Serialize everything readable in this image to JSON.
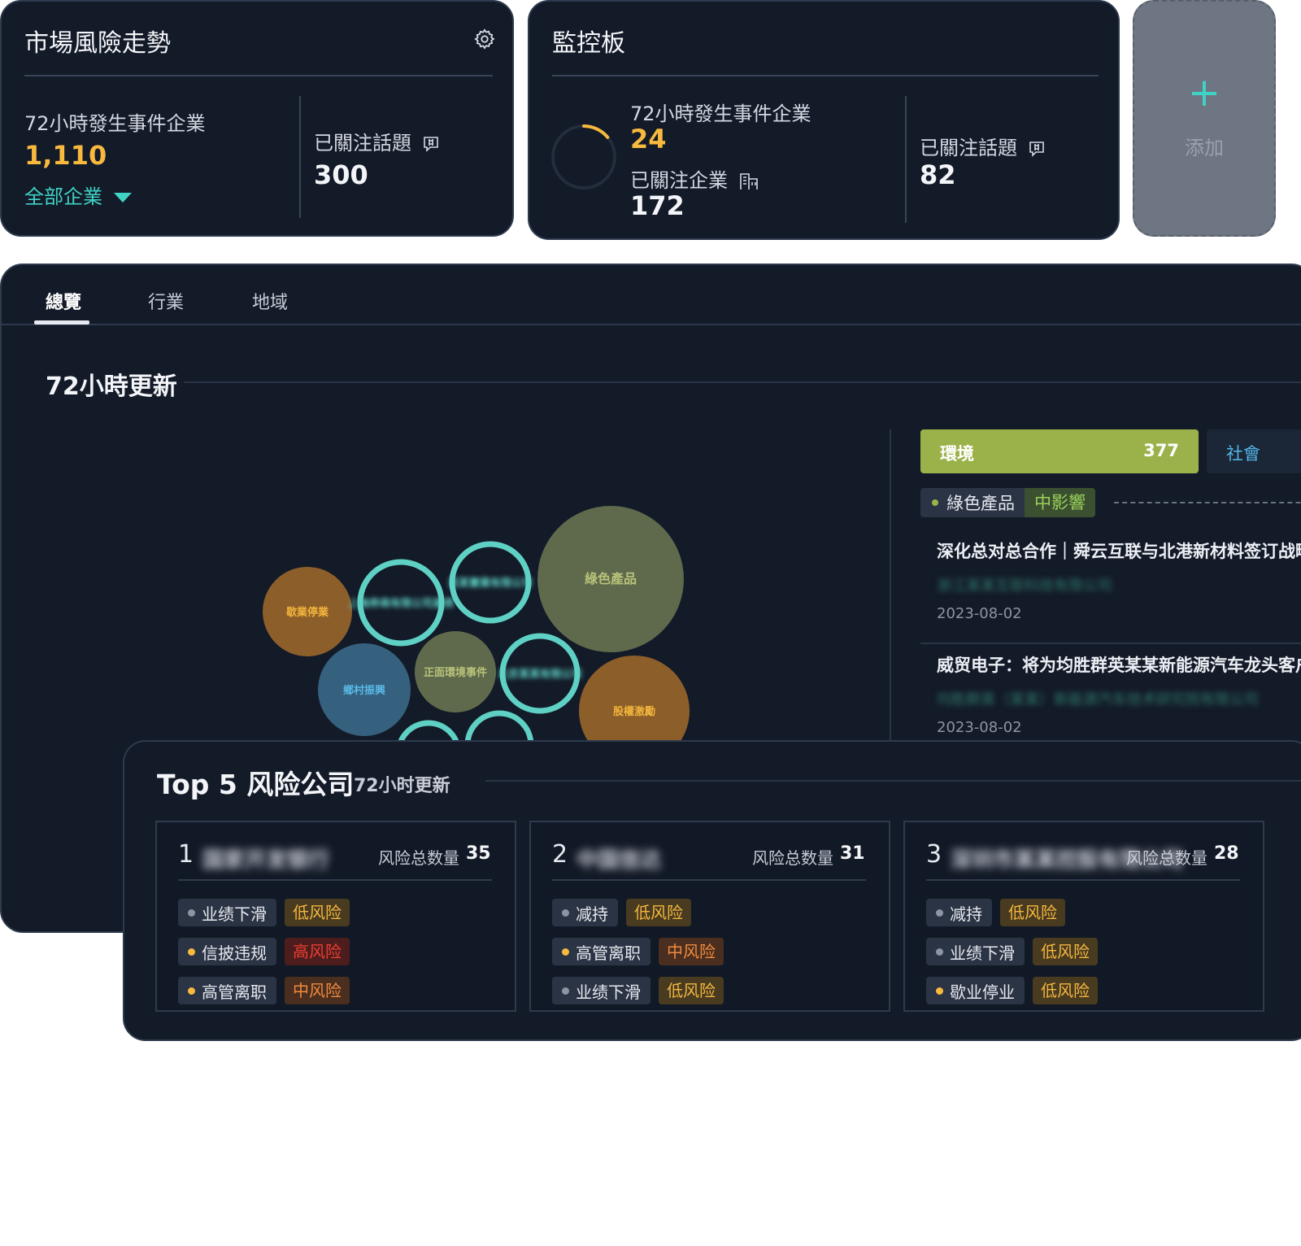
{
  "market_risk_card": {
    "title": "市場風險走勢",
    "events_label": "72小時發生事件企業",
    "events_value": "1,110",
    "filter_label": "全部企業",
    "topics_label": "已關注話題",
    "topics_value": "300"
  },
  "monitor_card": {
    "title": "監控板",
    "events_label": "72小時發生事件企業",
    "events_value": "24",
    "followed_label": "已關注企業",
    "followed_value": "172",
    "topics_label": "已關注話題",
    "topics_value": "82",
    "ring_progress": 0.14
  },
  "add_card": {
    "label": "添加"
  },
  "tabs": [
    "總覽",
    "行業",
    "地域"
  ],
  "update_section": {
    "title": "72小時更新",
    "bubbles": [
      {
        "label": "歇業停業",
        "color": "#8c5e2a",
        "text_color": "#f2b53c",
        "style": "fill"
      },
      {
        "label": "上海券商有限公司違規",
        "color": "#131a28",
        "ring": "#5fd0c4",
        "text_color": "#5fd0c4",
        "style": "ring",
        "blurred": true
      },
      {
        "label": "某某實業有限公司",
        "color": "#131a28",
        "ring": "#5fd0c4",
        "text_color": "#5fd0c4",
        "style": "ring",
        "blurred": true
      },
      {
        "label": "綠色產品",
        "color": "#5f6a4c",
        "text_color": "#b8c27a",
        "style": "fill"
      },
      {
        "label": "鄉村振興",
        "color": "#35607e",
        "text_color": "#59b8e6",
        "style": "fill"
      },
      {
        "label": "正面環境事件",
        "color": "#5f6a4c",
        "text_color": "#b8c27a",
        "style": "fill"
      },
      {
        "label": "北京某某有限公司",
        "color": "#131a28",
        "ring": "#5fd0c4",
        "text_color": "#5fd0c4",
        "style": "ring",
        "blurred": true
      },
      {
        "label": "股權激勵",
        "color": "#8c5e2a",
        "text_color": "#f2b53c",
        "style": "fill"
      },
      {
        "label": "",
        "color": "#131a28",
        "ring": "#5fd0c4",
        "text_color": "#5fd0c4",
        "style": "ring"
      },
      {
        "label": "",
        "color": "#131a28",
        "ring": "#5fd0c4",
        "text_color": "#5fd0c4",
        "style": "ring"
      }
    ],
    "category_env": {
      "name": "環境",
      "count": "377"
    },
    "category_social": {
      "name": "社會"
    },
    "topic": {
      "name": "綠色產品",
      "impact": "中影響"
    },
    "news": [
      {
        "headline": "深化总对总合作｜舜云互联与北港新材料签订战略",
        "company": "浙江某某互联科技有限公司",
        "date": "2023-08-02"
      },
      {
        "headline": "威贸电子：将为均胜群英某某新能源汽车龙头客户项",
        "company": "均胜群英（某某）新能源汽车技术研究院有限公司",
        "date": "2023-08-02"
      }
    ]
  },
  "top5": {
    "title": "Top 5 风险公司",
    "subtitle": "72小时更新",
    "total_label": "风险总数量",
    "companies": [
      {
        "rank": "1",
        "name": "国家开发银行",
        "total": "35",
        "risks": [
          {
            "name": "业绩下滑",
            "dot": "#8d95a3",
            "level": "低风险",
            "level_class": "low"
          },
          {
            "name": "信披违规",
            "dot": "#f7b93e",
            "level": "高风险",
            "level_class": "high"
          },
          {
            "name": "高管离职",
            "dot": "#f7b93e",
            "level": "中风险",
            "level_class": "mid"
          }
        ]
      },
      {
        "rank": "2",
        "name": "中国信达",
        "total": "31",
        "risks": [
          {
            "name": "减持",
            "dot": "#8d95a3",
            "level": "低风险",
            "level_class": "low"
          },
          {
            "name": "高管离职",
            "dot": "#f7b93e",
            "level": "中风险",
            "level_class": "mid"
          },
          {
            "name": "业绩下滑",
            "dot": "#8d95a3",
            "level": "低风险",
            "level_class": "low"
          }
        ]
      },
      {
        "rank": "3",
        "name": "深圳市某某控股有限公司",
        "total": "28",
        "risks": [
          {
            "name": "减持",
            "dot": "#8d95a3",
            "level": "低风险",
            "level_class": "low"
          },
          {
            "name": "业绩下滑",
            "dot": "#8d95a3",
            "level": "低风险",
            "level_class": "low"
          },
          {
            "name": "歇业停业",
            "dot": "#f7b93e",
            "level": "低风险",
            "level_class": "low"
          }
        ]
      }
    ]
  }
}
